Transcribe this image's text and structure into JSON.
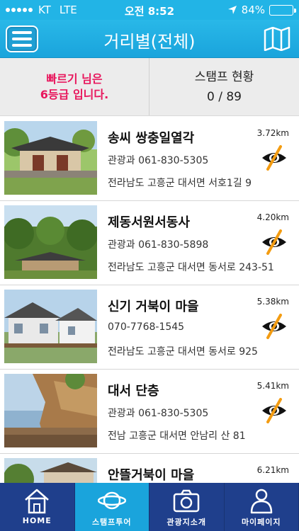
{
  "status_bar": {
    "carrier": "KT",
    "network": "LTE",
    "time": "오전 8:52",
    "battery": "84%",
    "battery_level": 0.84
  },
  "nav": {
    "title": "거리별(전체)",
    "menu_icon": "hamburger-menu-icon",
    "map_icon": "map-icon"
  },
  "summary": {
    "user_line1": "빠르기 님은",
    "user_line2": "6등급 입니다.",
    "stamp_title": "스탬프 현황",
    "stamp_count": "0 / 89"
  },
  "places": [
    {
      "name": "송씨 쌍충일열각",
      "distance": "3.72km",
      "phone": "관광과 061-830-5305",
      "address": "전라남도 고흥군 대서면 서호1길 9"
    },
    {
      "name": "제동서원서동사",
      "distance": "4.20km",
      "phone": "관광과 061-830-5898",
      "address": "전라남도 고흥군 대서면 동서로 243-51"
    },
    {
      "name": "신기 거북이 마을",
      "distance": "5.38km",
      "phone": "070-7768-1545",
      "address": "전라남도 고흥군 대서면 동서로 925"
    },
    {
      "name": "대서 단층",
      "distance": "5.41km",
      "phone": "관광과 061-830-5305",
      "address": "전남 고흥군 대서면 안남리 산 81"
    },
    {
      "name": "안뜰거북이 마을",
      "distance": "6.21km",
      "phone": "",
      "address": ""
    }
  ],
  "tabs": [
    {
      "label": "HOME",
      "icon": "home-icon"
    },
    {
      "label": "스탬프투어",
      "icon": "planet-icon"
    },
    {
      "label": "관광지소개",
      "icon": "camera-icon"
    },
    {
      "label": "마이페이지",
      "icon": "person-icon"
    }
  ],
  "colors": {
    "accent": "#1aa4dc",
    "tab_bar": "#1f3f8c",
    "highlight_text": "#e8175d",
    "eye_slash": "#f39c12"
  }
}
